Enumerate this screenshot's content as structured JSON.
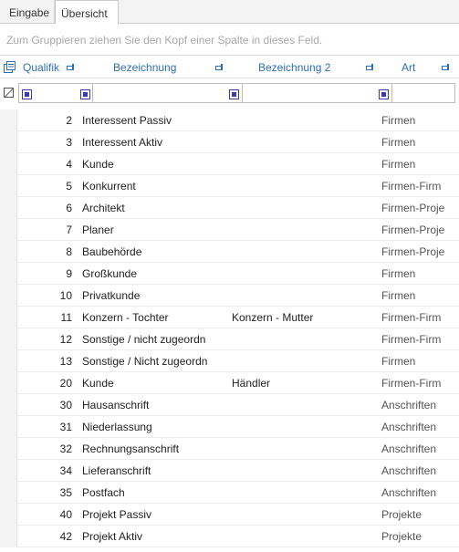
{
  "tabs": [
    {
      "label": "Eingabe",
      "active": false
    },
    {
      "label": "Übersicht",
      "active": true
    }
  ],
  "group_panel": {
    "hint": "Zum Gruppieren ziehen Sie den Kopf einer Spalte in dieses Feld."
  },
  "columns": [
    {
      "label": "Qualifik"
    },
    {
      "label": "Bezeichnung"
    },
    {
      "label": "Bezeichnung 2"
    },
    {
      "label": "Art"
    }
  ],
  "icons": {
    "column_chooser": "column-chooser-icon",
    "pin": "pin-icon",
    "filter_clear": "filter-clear-icon",
    "filter_toggle": "filter-checkbox-icon"
  },
  "colors": {
    "header_text": "#2e6fb7",
    "filter_check": "#3a3ab0"
  },
  "rows": [
    {
      "q": "2",
      "b": "Interessent Passiv",
      "b2": "",
      "a": "Firmen"
    },
    {
      "q": "3",
      "b": "Interessent Aktiv",
      "b2": "",
      "a": "Firmen"
    },
    {
      "q": "4",
      "b": "Kunde",
      "b2": "",
      "a": "Firmen"
    },
    {
      "q": "5",
      "b": "Konkurrent",
      "b2": "",
      "a": "Firmen-Firm"
    },
    {
      "q": "6",
      "b": "Architekt",
      "b2": "",
      "a": "Firmen-Proje"
    },
    {
      "q": "7",
      "b": "Planer",
      "b2": "",
      "a": "Firmen-Proje"
    },
    {
      "q": "8",
      "b": "Baubehörde",
      "b2": "",
      "a": "Firmen-Proje"
    },
    {
      "q": "9",
      "b": "Großkunde",
      "b2": "",
      "a": "Firmen"
    },
    {
      "q": "10",
      "b": "Privatkunde",
      "b2": "",
      "a": "Firmen"
    },
    {
      "q": "11",
      "b": "Konzern - Tochter",
      "b2": "Konzern - Mutter",
      "a": "Firmen-Firm"
    },
    {
      "q": "12",
      "b": "Sonstige / nicht zugeordn",
      "b2": "",
      "a": "Firmen-Firm"
    },
    {
      "q": "13",
      "b": "Sonstige / Nicht zugeordn",
      "b2": "",
      "a": "Firmen"
    },
    {
      "q": "20",
      "b": "Kunde",
      "b2": "Händler",
      "a": "Firmen-Firm"
    },
    {
      "q": "30",
      "b": "Hausanschrift",
      "b2": "",
      "a": "Anschriften"
    },
    {
      "q": "31",
      "b": "Niederlassung",
      "b2": "",
      "a": "Anschriften"
    },
    {
      "q": "32",
      "b": "Rechnungsanschrift",
      "b2": "",
      "a": "Anschriften"
    },
    {
      "q": "34",
      "b": "Lieferanschrift",
      "b2": "",
      "a": "Anschriften"
    },
    {
      "q": "35",
      "b": "Postfach",
      "b2": "",
      "a": "Anschriften"
    },
    {
      "q": "40",
      "b": "Projekt Passiv",
      "b2": "",
      "a": "Projekte"
    },
    {
      "q": "42",
      "b": "Projekt Aktiv",
      "b2": "",
      "a": "Projekte"
    }
  ]
}
